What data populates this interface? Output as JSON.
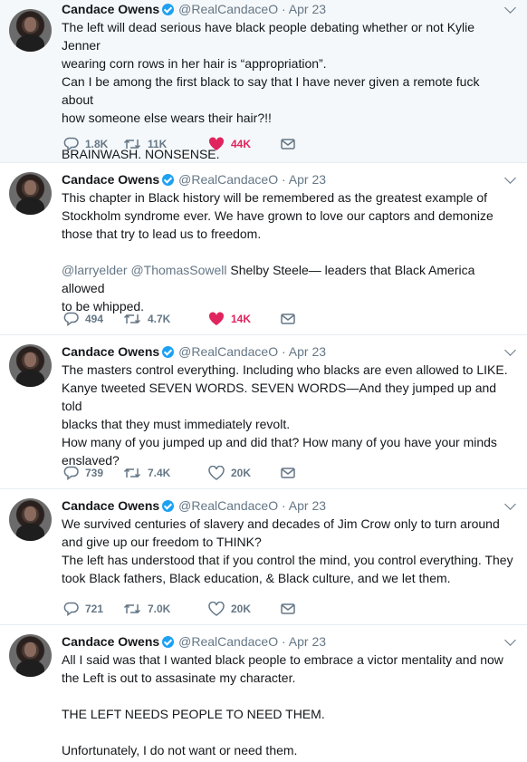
{
  "tweets": [
    {
      "name": "Candace Owens",
      "handle": "@RealCandaceO",
      "separator": "·",
      "time": "Apr 23",
      "lines": [
        "The left will dead serious have black people debating whether or not Kylie Jenner",
        "wearing corn rows in her hair is “appropriation”.",
        "Can I be among the first black to say that I have never given a remote fuck about",
        "how someone else wears their hair?!!",
        "",
        "BRAINWASH. NONSENSE."
      ],
      "replies": "1.8K",
      "retweets": "11K",
      "likes": "44K",
      "liked": true
    },
    {
      "name": "Candace Owens",
      "handle": "@RealCandaceO",
      "separator": "·",
      "time": "Apr 23",
      "lines": [
        "This chapter in Black history will be remembered as the greatest example of",
        "Stockholm syndrome ever. We have grown to love our captors and demonize",
        "those that try to lead us to freedom.",
        ""
      ],
      "mentions": "@larryelder @ThomasSowell",
      "mention_tail": " Shelby Steele— leaders that Black America allowed",
      "last_line": "to be whipped.",
      "replies": "494",
      "retweets": "4.7K",
      "likes": "14K",
      "liked": true
    },
    {
      "name": "Candace Owens",
      "handle": "@RealCandaceO",
      "separator": "·",
      "time": "Apr 23",
      "lines": [
        "The masters control everything. Including who blacks are even allowed to LIKE.",
        "Kanye tweeted SEVEN WORDS. SEVEN WORDS—And they jumped up and told",
        "blacks that they must immediately revolt.",
        "How many of you jumped up and did that? How many of you have your minds",
        "enslaved?"
      ],
      "replies": "739",
      "retweets": "7.4K",
      "likes": "20K",
      "liked": false
    },
    {
      "name": "Candace Owens",
      "handle": "@RealCandaceO",
      "separator": "·",
      "time": "Apr 23",
      "lines": [
        "We survived centuries of slavery and decades of Jim Crow only to turn around",
        "and give up our freedom to THINK?",
        "The left has understood that if you control the mind, you control everything. They",
        "took Black fathers, Black education, & Black culture, and we let them."
      ],
      "replies": "721",
      "retweets": "7.0K",
      "likes": "20K",
      "liked": false
    },
    {
      "name": "Candace Owens",
      "handle": "@RealCandaceO",
      "separator": "·",
      "time": "Apr 23",
      "lines": [
        "All I said was that I wanted black people to embrace a victor mentality and now",
        "the Left is out to assasinate my character.",
        "",
        "THE LEFT NEEDS PEOPLE TO NEED THEM.",
        "",
        "Unfortunately, I do not want or need them."
      ]
    }
  ],
  "colors": {
    "accent": "#1da1f2",
    "like": "#e0245e",
    "muted": "#657786",
    "highlight_bg": "#f5f8fa"
  },
  "icons": [
    "reply-icon",
    "retweet-icon",
    "like-icon",
    "message-icon",
    "verified-icon",
    "caret-icon"
  ]
}
